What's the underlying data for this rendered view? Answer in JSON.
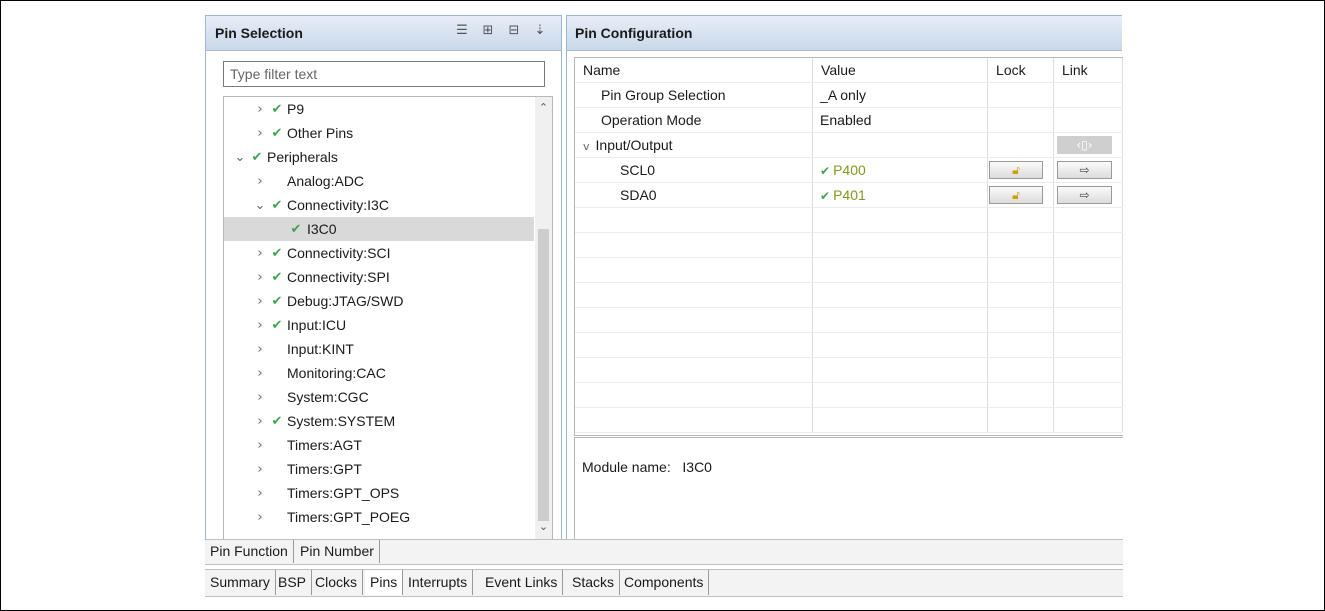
{
  "pin_selection": {
    "title": "Pin Selection",
    "filter_placeholder": "Type filter text",
    "tree": [
      {
        "label": "P9",
        "level": 1,
        "arrow": ">",
        "check": true
      },
      {
        "label": "Other Pins",
        "level": 1,
        "arrow": ">",
        "check": true
      },
      {
        "label": "Peripherals",
        "level": 0,
        "arrow": "v",
        "check": true
      },
      {
        "label": "Analog:ADC",
        "level": 1,
        "arrow": ">",
        "check": false
      },
      {
        "label": "Connectivity:I3C",
        "level": 1,
        "arrow": "v",
        "check": true
      },
      {
        "label": "I3C0",
        "level": 2,
        "arrow": "",
        "check": true,
        "selected": true
      },
      {
        "label": "Connectivity:SCI",
        "level": 1,
        "arrow": ">",
        "check": true
      },
      {
        "label": "Connectivity:SPI",
        "level": 1,
        "arrow": ">",
        "check": true
      },
      {
        "label": "Debug:JTAG/SWD",
        "level": 1,
        "arrow": ">",
        "check": true
      },
      {
        "label": "Input:ICU",
        "level": 1,
        "arrow": ">",
        "check": true
      },
      {
        "label": "Input:KINT",
        "level": 1,
        "arrow": ">",
        "check": false
      },
      {
        "label": "Monitoring:CAC",
        "level": 1,
        "arrow": ">",
        "check": false
      },
      {
        "label": "System:CGC",
        "level": 1,
        "arrow": ">",
        "check": false
      },
      {
        "label": "System:SYSTEM",
        "level": 1,
        "arrow": ">",
        "check": true
      },
      {
        "label": "Timers:AGT",
        "level": 1,
        "arrow": ">",
        "check": false
      },
      {
        "label": "Timers:GPT",
        "level": 1,
        "arrow": ">",
        "check": false
      },
      {
        "label": "Timers:GPT_OPS",
        "level": 1,
        "arrow": ">",
        "check": false
      },
      {
        "label": "Timers:GPT_POEG",
        "level": 1,
        "arrow": ">",
        "check": false
      }
    ]
  },
  "pin_configuration": {
    "title": "Pin Configuration",
    "columns": [
      "Name",
      "Value",
      "Lock",
      "Link"
    ],
    "rows": [
      {
        "name": "Pin Group Selection",
        "value": "_A only"
      },
      {
        "name": "Operation Mode",
        "value": "Enabled"
      },
      {
        "name": "Input/Output",
        "value": ""
      },
      {
        "name": "SCL0",
        "value": "P400"
      },
      {
        "name": "SDA0",
        "value": "P401"
      }
    ],
    "module_label": "Module name:",
    "module_name": "I3C0"
  },
  "pin_tabs": [
    "Pin Function",
    "Pin Number"
  ],
  "editor_tabs": [
    "Summary",
    "BSP",
    "Clocks",
    "Pins",
    "Interrupts",
    "Event Links",
    "Stacks",
    "Components"
  ],
  "active_editor_tab": "Pins",
  "colors": {
    "check": "#3fa34d",
    "pin_value": "#7f9a1e",
    "header_bg": "#c9d8ea"
  }
}
